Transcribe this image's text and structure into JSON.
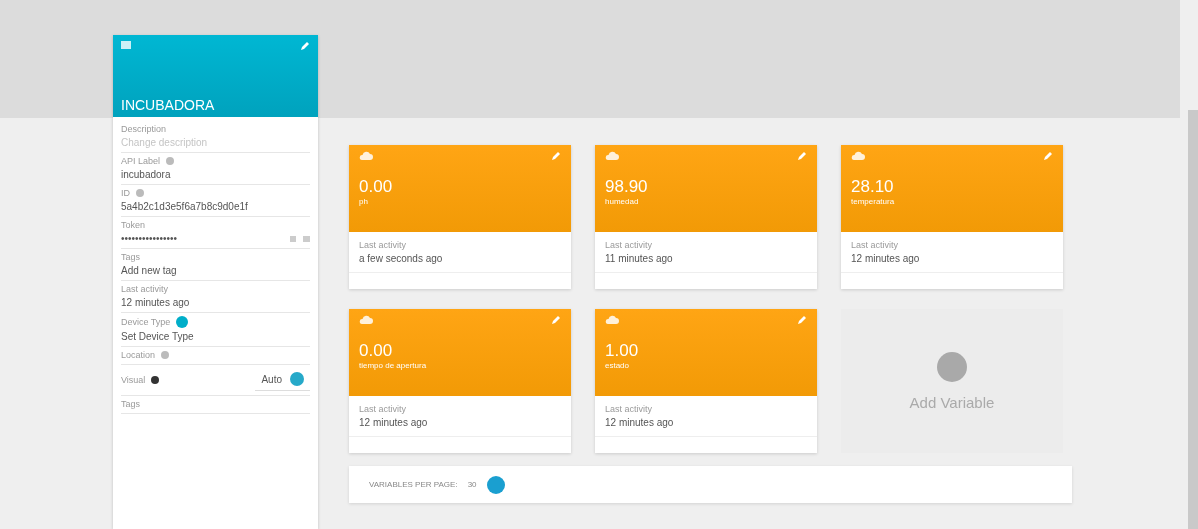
{
  "device": {
    "name": "INCUBADORA",
    "fields": [
      {
        "kind": "text",
        "label": "Description",
        "placeholder": "Change description"
      },
      {
        "kind": "text",
        "label": "API Label",
        "value": "incubadora",
        "help": true
      },
      {
        "kind": "text",
        "label": "ID",
        "value": "5a4b2c1d3e5f6a7b8c9d0e1f",
        "help": true
      },
      {
        "kind": "token",
        "label": "Token",
        "value": "••••••••••••••••"
      },
      {
        "kind": "text",
        "label": "Tags",
        "value": "Add new tag"
      },
      {
        "kind": "text",
        "label": "Last activity",
        "value": "12 minutes ago"
      },
      {
        "kind": "badge",
        "label": "Device Type",
        "value": "Set Device Type"
      },
      {
        "kind": "label",
        "label": "Location",
        "help": true
      },
      {
        "kind": "select",
        "label": "Visual",
        "value": "Auto"
      },
      {
        "kind": "label",
        "label": "Tags"
      }
    ]
  },
  "variables": [
    {
      "value": "0.00",
      "name": "ph",
      "activity_label": "Last activity",
      "activity": "a few seconds ago"
    },
    {
      "value": "98.90",
      "name": "humedad",
      "activity_label": "Last activity",
      "activity": "11 minutes ago"
    },
    {
      "value": "28.10",
      "name": "temperatura",
      "activity_label": "Last activity",
      "activity": "12 minutes ago"
    },
    {
      "value": "0.00",
      "name": "tiempo de apertura",
      "activity_label": "Last activity",
      "activity": "12 minutes ago"
    },
    {
      "value": "1.00",
      "name": "estado",
      "activity_label": "Last activity",
      "activity": "12 minutes ago"
    }
  ],
  "add_variable": "Add Variable",
  "pagination": {
    "label": "VARIABLES PER PAGE:",
    "value": "30"
  }
}
